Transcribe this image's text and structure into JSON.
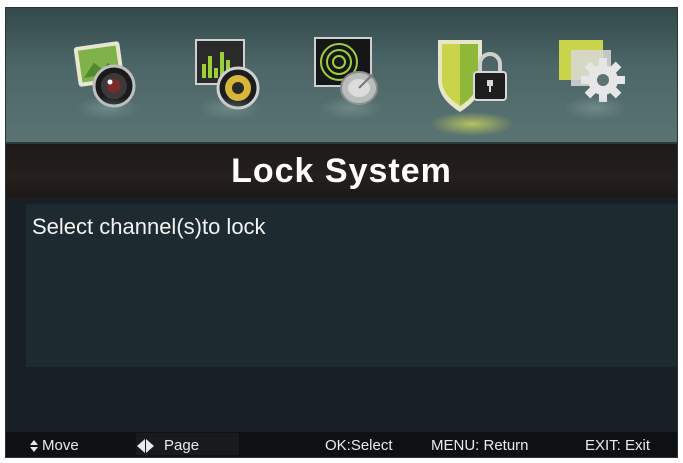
{
  "title": "Lock System",
  "prompt": "Select channel(s)to lock",
  "tabs": [
    {
      "icon": "picture-icon",
      "active": false
    },
    {
      "icon": "sound-icon",
      "active": false
    },
    {
      "icon": "channel-icon",
      "active": false
    },
    {
      "icon": "lock-icon",
      "active": true
    },
    {
      "icon": "setup-icon",
      "active": false
    }
  ],
  "footer": {
    "move": "Move",
    "page": "Page",
    "ok": "OK:Select",
    "menu": "MENU: Return",
    "exit": "EXIT: Exit"
  },
  "colors": {
    "accent": "#d7dc5a",
    "background": "#182025",
    "title_bar": "#211d1b",
    "icon_bar": "#4d6769"
  }
}
